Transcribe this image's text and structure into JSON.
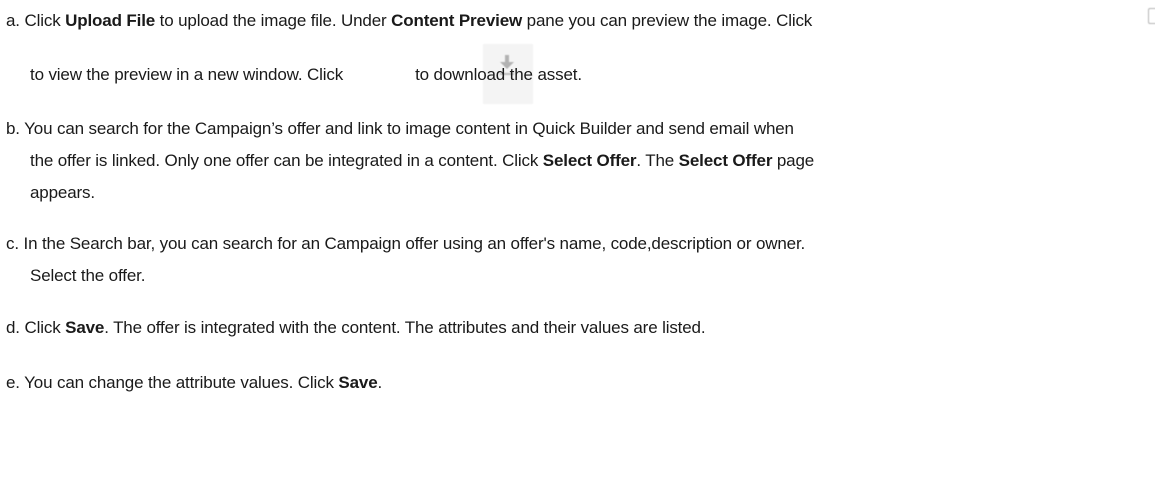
{
  "steps": [
    {
      "marker": "a.",
      "line1": [
        {
          "text": "Click ",
          "bold": false
        },
        {
          "text": "Upload File",
          "bold": true
        },
        {
          "text": " to upload the image file. Under ",
          "bold": false
        },
        {
          "text": "Content Preview",
          "bold": true
        },
        {
          "text": " pane you can preview the image. Click",
          "bold": false
        }
      ],
      "line2_before_icon": "to view the preview in a new window. Click",
      "line2_after_icon": "to download the asset."
    },
    {
      "marker": "b.",
      "line1": "You can search for the Campaign’s offer and link to image content in Quick Builder and send email when",
      "line2": [
        {
          "text": "the offer is linked. Only one offer can be integrated in a content. Click ",
          "bold": false
        },
        {
          "text": "Select Offer",
          "bold": true
        },
        {
          "text": ". The ",
          "bold": false
        },
        {
          "text": "Select Offer",
          "bold": true
        },
        {
          "text": " page",
          "bold": false
        }
      ],
      "line3": "appears."
    },
    {
      "marker": "c.",
      "line1": "In the Search bar, you can search for an Campaign offer using an offer's name, code,description or owner.",
      "line2": "Select the offer."
    },
    {
      "marker": "d.",
      "line1": [
        {
          "text": "Click ",
          "bold": false
        },
        {
          "text": "Save",
          "bold": true
        },
        {
          "text": ". The offer is integrated with the content. The attributes and their values are listed.",
          "bold": false
        }
      ]
    },
    {
      "marker": "e.",
      "line1": [
        {
          "text": "You can change the attribute values. Click ",
          "bold": false
        },
        {
          "text": "Save",
          "bold": true
        },
        {
          "text": ".",
          "bold": false
        }
      ]
    }
  ],
  "icons": {
    "preview_new_window": "open-window-icon",
    "download_asset": "download-icon"
  }
}
